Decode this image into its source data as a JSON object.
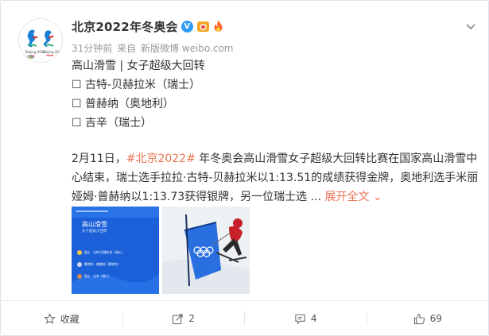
{
  "post": {
    "author": "北京2022年冬奥会",
    "time": "31分钟前",
    "source_prefix": "来自",
    "source": "新版微博 weibo.com",
    "title_line": "高山滑雪 | 女子超级大回转",
    "medal_lines": [
      {
        "box": "☐",
        "text": "古特-贝赫拉米（瑞士）"
      },
      {
        "box": "☐",
        "text": "普赫纳（奥地利）"
      },
      {
        "box": "☐",
        "text": "吉辛（瑞士）"
      }
    ],
    "body_prefix": "2月11日，",
    "hashtag": "#北京2022#",
    "body_text": " 年冬奥会高山滑雪女子超级大回转比赛在国家高山滑雪中心结束，瑞士选手拉拉·古特-贝赫拉米以1:13.51的成绩获得金牌，奥地利选手米丽娅姆·普赫纳以1:13.73获得银牌，另一位瑞士选 ... ",
    "expand_label": "展开全文",
    "expand_arrow": "⌄"
  },
  "image1": {
    "title": "高山滑雪",
    "subtitle": "女子超级大回转",
    "rows": [
      "瑞士 · 古特-贝赫拉米（瑞士）",
      "奥地利 · 普赫纳（奥地利）",
      "瑞士 · 吉辛（瑞士）"
    ]
  },
  "footer": {
    "favorite_label": "收藏",
    "repost_count": "2",
    "comment_count": "4",
    "like_count": "69"
  },
  "colors": {
    "accent": "#eb7350",
    "verified": "#2f9bf6",
    "image_blue": "#1b60d8"
  }
}
